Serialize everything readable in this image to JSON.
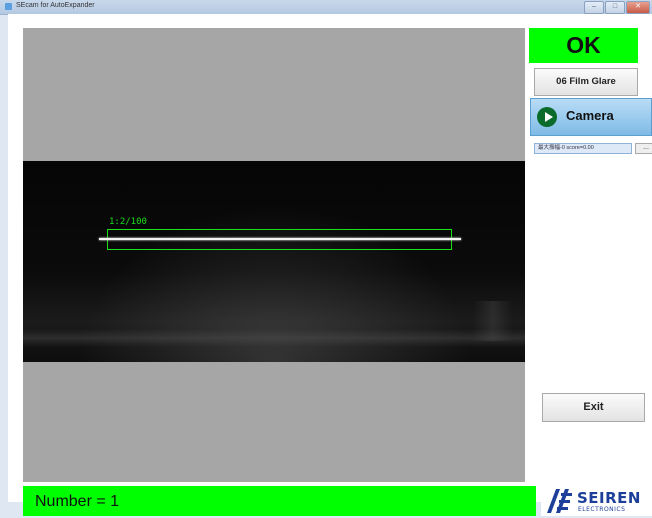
{
  "window": {
    "title": "SEcam for AutoExpander",
    "controls": {
      "minimize": "–",
      "maximize": "□",
      "close": "✕"
    }
  },
  "camera_view": {
    "roi_label": "1:2/100"
  },
  "status": {
    "result": "OK",
    "result_color": "#00ff00"
  },
  "controls": {
    "mode_label": "06 Film Glare",
    "camera_label": "Camera",
    "camera_icon": "play-icon",
    "info_text": "最大振幅-0 score=0.00",
    "more_label": "...",
    "exit_label": "Exit"
  },
  "footer": {
    "number_text": "Number = 1",
    "logo_text": "SEIREN",
    "logo_subtext": "ELECTRONICS"
  }
}
